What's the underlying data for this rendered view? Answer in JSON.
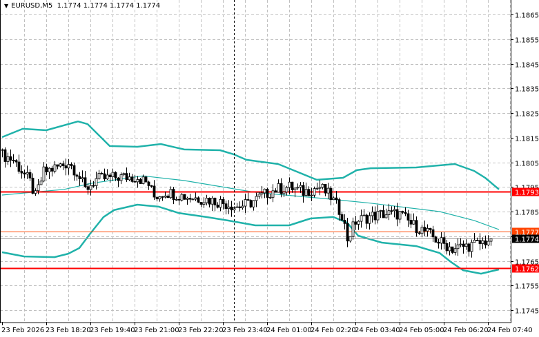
{
  "header": {
    "symbol": "EURUSD,M5",
    "ohlc": "1.1774 1.1774 1.1774 1.1774",
    "menu_icon": "triangle-down-icon"
  },
  "price_axis": {
    "ticks": [
      "1.1865",
      "1.1855",
      "1.1845",
      "1.1835",
      "1.1825",
      "1.1815",
      "1.1805",
      "1.1795",
      "1.1785",
      "1.1775",
      "1.1765",
      "1.1755",
      "1.1745"
    ],
    "tick_values": [
      1.1865,
      1.1855,
      1.1845,
      1.1835,
      1.1825,
      1.1815,
      1.1805,
      1.1795,
      1.1785,
      1.1775,
      1.1765,
      1.1755,
      1.1745
    ]
  },
  "time_axis": {
    "labels": [
      "23 Feb 2026",
      "23 Feb 18:20",
      "23 Feb 19:40",
      "23 Feb 21:00",
      "23 Feb 22:20",
      "23 Feb 23:40",
      "24 Feb 01:00",
      "24 Feb 02:20",
      "24 Feb 03:40",
      "24 Feb 05:00",
      "24 Feb 06:20",
      "24 Feb 07:40"
    ],
    "bars_per_label": 16
  },
  "levels": [
    {
      "label": "1.1793",
      "value": 1.1793,
      "color": "#ff0000",
      "kind": "resistance"
    },
    {
      "label": "1.1762",
      "value": 1.1762,
      "color": "#ff0000",
      "kind": "support"
    },
    {
      "label": "1.1777",
      "value": 1.1777,
      "color": "#ff4500",
      "kind": "ask"
    },
    {
      "label": "1.1774",
      "value": 1.1774,
      "color": "#000000",
      "kind": "bid"
    }
  ],
  "colors": {
    "band": "#20b2aa",
    "grid": "#c0c0c0",
    "bull_fill": "#ffffff",
    "bear_fill": "#000000"
  },
  "chart_data": {
    "type": "candlestick",
    "title": "EURUSD,M5",
    "bar_count": 178,
    "close_waypoints": [
      [
        0,
        1.1808
      ],
      [
        4,
        1.1806
      ],
      [
        10,
        1.1797
      ],
      [
        12,
        1.1791
      ],
      [
        15,
        1.1801
      ],
      [
        22,
        1.1804
      ],
      [
        24,
        1.1805
      ],
      [
        27,
        1.1801
      ],
      [
        30,
        1.1794
      ],
      [
        34,
        1.1798
      ],
      [
        42,
        1.1799
      ],
      [
        49,
        1.1799
      ],
      [
        53,
        1.1796
      ],
      [
        55,
        1.1791
      ],
      [
        59,
        1.1793
      ],
      [
        67,
        1.1791
      ],
      [
        74,
        1.179
      ],
      [
        82,
        1.1788
      ],
      [
        85,
        1.1787
      ],
      [
        89,
        1.1788
      ],
      [
        95,
        1.1792
      ],
      [
        99,
        1.1794
      ],
      [
        104,
        1.1795
      ],
      [
        109,
        1.1793
      ],
      [
        115,
        1.1795
      ],
      [
        119,
        1.1791
      ],
      [
        123,
        1.1784
      ],
      [
        125,
        1.1774
      ],
      [
        128,
        1.1781
      ],
      [
        133,
        1.1783
      ],
      [
        138,
        1.1784
      ],
      [
        144,
        1.1784
      ],
      [
        148,
        1.178
      ],
      [
        153,
        1.1777
      ],
      [
        158,
        1.1773
      ],
      [
        163,
        1.177
      ],
      [
        168,
        1.1771
      ],
      [
        173,
        1.1772
      ],
      [
        177,
        1.1774
      ]
    ],
    "bollinger_upper": [
      [
        0,
        1.18152
      ],
      [
        7.5,
        1.18186
      ],
      [
        16,
        1.1818
      ],
      [
        27.5,
        1.18216
      ],
      [
        31,
        1.18205
      ],
      [
        39,
        1.18116
      ],
      [
        49,
        1.18113
      ],
      [
        57.5,
        1.18124
      ],
      [
        66,
        1.18102
      ],
      [
        79,
        1.18099
      ],
      [
        84,
        1.18082
      ],
      [
        88.5,
        1.1806
      ],
      [
        100,
        1.18043
      ],
      [
        108.5,
        1.18004
      ],
      [
        114,
        1.17979
      ],
      [
        123.5,
        1.17987
      ],
      [
        128.5,
        1.18018
      ],
      [
        133.5,
        1.18026
      ],
      [
        150,
        1.18029
      ],
      [
        164,
        1.18043
      ],
      [
        171,
        1.18015
      ],
      [
        175,
        1.17987
      ],
      [
        180,
        1.1794
      ]
    ],
    "bollinger_middle": [
      [
        0,
        1.17917
      ],
      [
        22.5,
        1.1794
      ],
      [
        32.5,
        1.17965
      ],
      [
        51,
        1.17995
      ],
      [
        66,
        1.17976
      ],
      [
        82.5,
        1.17945
      ],
      [
        91.75,
        1.17928
      ],
      [
        116.75,
        1.17903
      ],
      [
        133.5,
        1.17884
      ],
      [
        158.5,
        1.1785
      ],
      [
        171,
        1.17814
      ],
      [
        180,
        1.17777
      ]
    ],
    "bollinger_lower": [
      [
        0,
        1.17685
      ],
      [
        8,
        1.17668
      ],
      [
        19,
        1.17665
      ],
      [
        24,
        1.17679
      ],
      [
        28,
        1.17702
      ],
      [
        31.75,
        1.17758
      ],
      [
        36.75,
        1.17828
      ],
      [
        40.5,
        1.17856
      ],
      [
        49,
        1.17878
      ],
      [
        56.75,
        1.1787
      ],
      [
        64,
        1.17844
      ],
      [
        74,
        1.17828
      ],
      [
        81.75,
        1.17814
      ],
      [
        91.75,
        1.17794
      ],
      [
        104,
        1.17794
      ],
      [
        111.75,
        1.17822
      ],
      [
        120,
        1.17828
      ],
      [
        125,
        1.17805
      ],
      [
        129,
        1.17752
      ],
      [
        137.5,
        1.17724
      ],
      [
        150,
        1.1771
      ],
      [
        158.5,
        1.17682
      ],
      [
        162.5,
        1.17646
      ],
      [
        167,
        1.17612
      ],
      [
        173.5,
        1.17598
      ],
      [
        180,
        1.17615
      ]
    ],
    "separator_bar": 84,
    "ylim": [
      1.174,
      1.1871
    ]
  }
}
